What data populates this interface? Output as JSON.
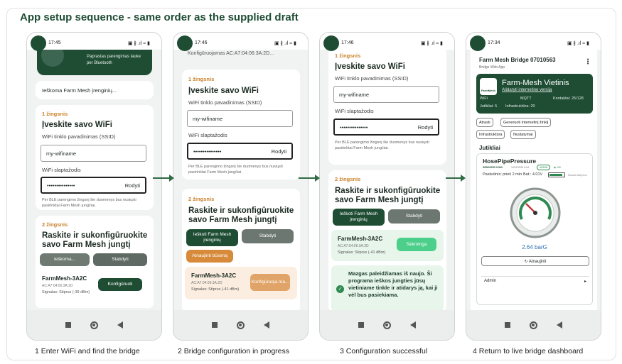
{
  "title": "App setup sequence - same order as the supplied draft",
  "captions": [
    "1  Enter WiFi and find the bridge",
    "2  Bridge configuration in progress",
    "3  Configuration successful",
    "4  Return to live bridge dashboard"
  ],
  "phone1": {
    "time": "17:45",
    "status_icons": "▣ ∦ .ıl ≈ ▮",
    "banner_text": "Paprastas parengimas lauke per Bluetooth",
    "searching": "Ieškoma Farm Mesh įrenginių...",
    "step1": "1 žingsnis",
    "wifi_title": "Įveskite savo WiFi",
    "ssid_label": "WiFi tinklo pavadinimas (SSID)",
    "ssid_value": "my-wifiname",
    "pass_label": "WiFi slaptažodis",
    "pass_value": "•••••••••••••••",
    "show": "Rodyti",
    "hint": "Per BLE parengimo žingsnį šie duomenys bus nusiųsti pasirinktai Farm Mesh jungčiai.",
    "step2": "2 žingsnis",
    "find_title": "Raskite ir sukonfigūruokite savo Farm Mesh jungtį",
    "searching_btn": "Ieškoma...",
    "stop_btn": "Stabdyti",
    "dev_name": "FarmMesh-3A2C",
    "dev_mac": "AC:A7:04:06:3A:2D",
    "dev_signal": "Signalas: Stiprus (-39 dBm)",
    "config_btn": "Konfigūruoti"
  },
  "phone2": {
    "time": "17:46",
    "status_icons": "▣ ∦ .ıl ≈ ▮",
    "top_text": "Konfigūruojamas AC:A7:04:06:3A:2D...",
    "step1": "1 žingsnis",
    "wifi_title": "Įveskite savo WiFi",
    "ssid_label": "WiFi tinklo pavadinimas (SSID)",
    "ssid_value": "my-wifiname",
    "pass_label": "WiFi slaptažodis",
    "pass_value": "•••••••••••••••",
    "show": "Rodyti",
    "hint": "Per BLE parengimo žingsnį šie duomenys bus nusiųsti pasirinktai Farm Mesh jungčiai.",
    "step2": "2 žingsnis",
    "find_title": "Raskite ir sukonfigūruokite savo Farm Mesh jungtį",
    "search_btn": "Ieškoti Farm Mesh įrenginių",
    "stop_btn": "Stabdyti",
    "refresh_btn": "Atnaujinti būseną",
    "dev_name": "FarmMesh-3A2C",
    "dev_mac": "AC:A7:04:06:3A:2D",
    "dev_signal": "Signalas: Stiprus (-41 dBm)",
    "config_btn": "Konfigūruoja ma..."
  },
  "phone3": {
    "time": "17:46",
    "status_icons": "▣ ∦ .ıl ≈ ▮",
    "step1": "1 žingsnis",
    "wifi_title": "Įveskite savo WiFi",
    "ssid_label": "WiFi tinklo pavadinimas (SSID)",
    "ssid_value": "my-wifiname",
    "pass_label": "WiFi slaptažodis",
    "pass_value": "•••••••••••••••",
    "show": "Rodyti",
    "hint": "Per BLE parengimo žingsnį šie duomenys bus nusiųsti pasirinktai Farm Mesh jungčiai.",
    "step2": "2 žingsnis",
    "find_title": "Raskite ir sukonfigūruokite savo Farm Mesh jungtį",
    "search_btn": "Ieškoti Farm Mesh įrenginių",
    "stop_btn": "Stabdyti",
    "dev_name": "FarmMesh-3A2C",
    "dev_mac": "AC:A7:04:06:3A:2D",
    "dev_signal": "Signalas: Stiprus (-41 dBm)",
    "success_btn": "Sėkminga",
    "success_msg": "Mazgas paleidžiamas iš naujo. Ši programa ieškos jungties jūsų vietiniame tinkle ir atidarys ją, kai ji vėl bus pasiekiama."
  },
  "phone4": {
    "time": "17:34",
    "status_icons": "▣ ∦ .ıl ≈ ▮",
    "app_title": "Farm Mesh Bridge 07010563",
    "app_sub": "Bridge Web App",
    "menu": "⋮",
    "logo_text": "FarmMesh",
    "hero_title": "Farm-Mesh Vietinis",
    "hero_link": "Atidaryti internetinę versiją",
    "wifi": "WiFi",
    "mqtt": "MQTT",
    "contacts": "Kontaktai: 25/128",
    "sensors_count": "Jutikliai: 5",
    "infra_count": "Infrastruktūra: 20",
    "chips": [
      "Atrasti",
      "Generuoti internetinį žinklį",
      "Infrastruktūra",
      "Nustatymai"
    ],
    "sensors_title": "Jutikliai",
    "sensor_name": "HosePipePressure",
    "sensor_tag": "SENSORS 01393",
    "sensor_id": "10/11/2025 6:04",
    "admin_badge": "ADMIN",
    "sensor_extra": "◉ 100",
    "last_seen": "Paskutinis: prieš 2 min",
    "battery": "Bat.: 4.01V",
    "battery_label": "Nuolat Aktyvus",
    "pressure": "2.64 barG",
    "refresh": "↻ Atnaujinti",
    "admin_select": "Admin",
    "admin_chevron": "▸",
    "colors": {
      "brand": "#1f4d34"
    }
  }
}
